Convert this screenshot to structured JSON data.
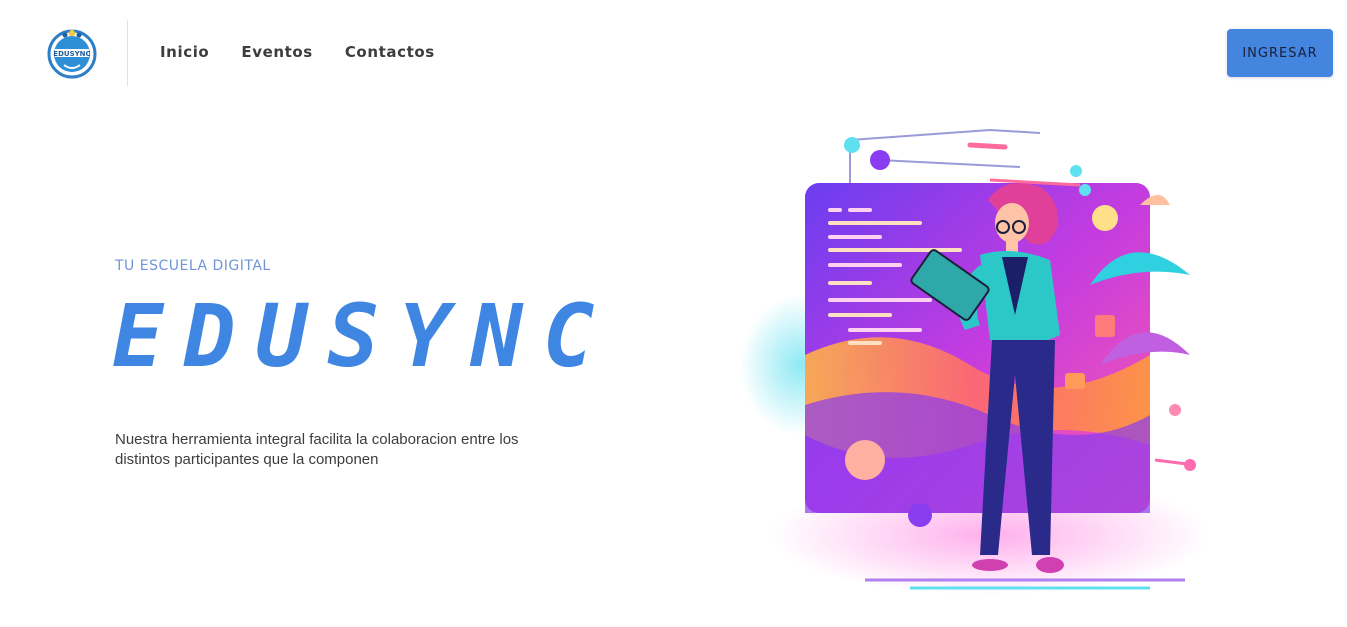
{
  "header": {
    "logo_text": "EDUSYNC",
    "nav": [
      {
        "label": "Inicio"
      },
      {
        "label": "Eventos"
      },
      {
        "label": "Contactos"
      }
    ],
    "login_label": "INGRESAR"
  },
  "hero": {
    "eyebrow": "TU ESCUELA DIGITAL",
    "title": "EDUSYNC",
    "description": "Nuestra herramienta integral facilita la colaboracion entre los distintos participantes que la componen"
  },
  "colors": {
    "accent": "#4485e0",
    "title": "#3f86e2",
    "eyebrow": "#6f95d8"
  },
  "icons": {
    "logo": "edusync-logo-icon",
    "illustration": "woman-with-tablet-illustration"
  }
}
